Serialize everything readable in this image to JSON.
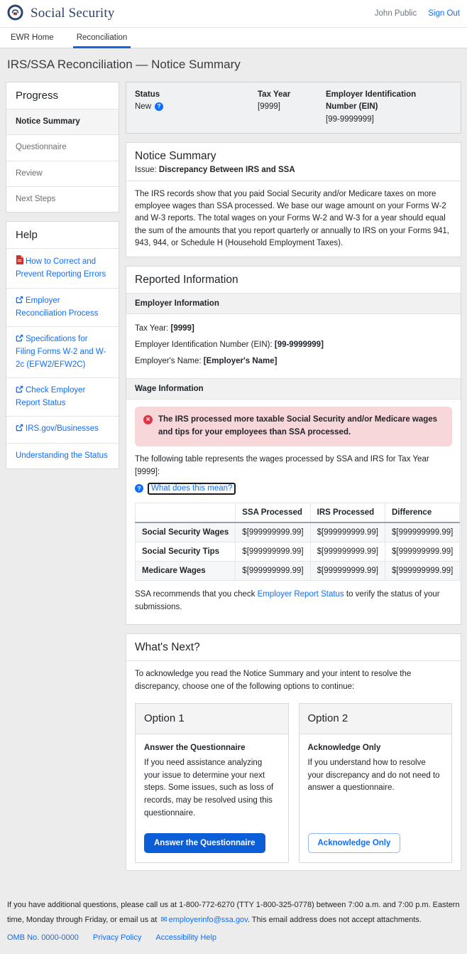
{
  "header": {
    "brand": "Social Security",
    "user_name": "John Public",
    "sign_out_label": "Sign Out"
  },
  "nav": {
    "tabs": [
      {
        "label": "EWR Home",
        "active": false
      },
      {
        "label": "Reconciliation",
        "active": true
      }
    ]
  },
  "page_title": "IRS/SSA Reconciliation — Notice Summary",
  "progress": {
    "title": "Progress",
    "steps": [
      {
        "label": "Notice Summary",
        "active": true
      },
      {
        "label": "Questionnaire",
        "active": false
      },
      {
        "label": "Review",
        "active": false
      },
      {
        "label": "Next Steps",
        "active": false
      }
    ]
  },
  "help": {
    "title": "Help",
    "links": [
      {
        "label": "How to Correct and Prevent Reporting Errors",
        "icon": "pdf-icon"
      },
      {
        "label": "Employer Reconciliation Process",
        "icon": "external-link-icon"
      },
      {
        "label": "Specifications for Filing Forms W-2 and W-2c (EFW2/EFW2C)",
        "icon": "external-link-icon"
      },
      {
        "label": "Check Employer Report Status",
        "icon": "external-link-icon"
      },
      {
        "label": "IRS.gov/Businesses",
        "icon": "external-link-icon"
      },
      {
        "label": "Understanding the Status",
        "icon": "none"
      }
    ]
  },
  "status_bar": {
    "status_label": "Status",
    "status_value": "New",
    "tax_year_label": "Tax Year",
    "tax_year_value": "[9999]",
    "ein_label": "Employer Identification Number (EIN)",
    "ein_value": "[99-9999999]"
  },
  "notice_summary": {
    "title": "Notice Summary",
    "issue_label": "Issue:",
    "issue_value": "Discrepancy Between IRS and SSA",
    "body": "The IRS records show that you paid Social Security and/or Medicare taxes on more employee wages than SSA processed. We base our wage amount on your Forms W-2 and W-3 reports. The total wages on your Forms W-2 and W-3 for a year should equal the sum of the amounts that you report quarterly or annually to IRS on your Forms 941, 943, 944, or Schedule H (Household Employment Taxes)."
  },
  "reported_information": {
    "title": "Reported Information",
    "employer_section": {
      "heading": "Employer Information",
      "tax_year_label": "Tax Year:",
      "tax_year_value": "[9999]",
      "ein_label": "Employer Identification Number (EIN):",
      "ein_value": "[99-9999999]",
      "name_label": "Employer's Name:",
      "name_value": "[Employer's Name]"
    },
    "wage_section": {
      "heading": "Wage Information",
      "alert_text": "The IRS processed more taxable Social Security and/or Medicare wages and tips for your employees than SSA processed.",
      "table_intro": "The following table represents the wages processed by SSA and IRS for Tax Year [9999]:",
      "help_link_label": "What does this mean?",
      "recommend_before": "SSA recommends that you check",
      "recommend_link": "Employer Report Status",
      "recommend_after": "to verify the status of your submissions."
    }
  },
  "chart_data": {
    "type": "table",
    "title": "Wages processed by SSA and IRS",
    "columns": [
      "",
      "SSA Processed",
      "IRS Processed",
      "Difference"
    ],
    "rows": [
      {
        "label": "Social Security Wages",
        "ssa": "$[999999999.99]",
        "irs": "$[999999999.99]",
        "diff": "$[999999999.99]"
      },
      {
        "label": "Social Security Tips",
        "ssa": "$[999999999.99]",
        "irs": "$[999999999.99]",
        "diff": "$[999999999.99]"
      },
      {
        "label": "Medicare Wages",
        "ssa": "$[999999999.99]",
        "irs": "$[999999999.99]",
        "diff": "$[999999999.99]"
      }
    ]
  },
  "whats_next": {
    "title": "What's Next?",
    "intro": "To acknowledge you read the Notice Summary and your intent to resolve the discrepancy, choose one of the following options to continue:",
    "options": [
      {
        "title": "Option 1",
        "heading": "Answer the Questionnaire",
        "description": "If you need assistance analyzing your issue to determine your next steps. Some issues, such as loss of records, may be resolved using this questionnaire.",
        "button_label": "Answer the Questionnaire"
      },
      {
        "title": "Option 2",
        "heading": "Acknowledge Only",
        "description": "If you understand how to resolve your discrepancy and do not need to answer a questionnaire.",
        "button_label": "Acknowledge Only"
      }
    ]
  },
  "footer": {
    "text_before_email": "If you have additional questions, please call us at 1-800-772-6270 (TTY 1-800-325-0778) between 7:00 a.m. and 7:00 p.m. Eastern time, Monday through Friday, or email us at",
    "email": "employerinfo@ssa.gov",
    "text_after_email": ". This email address does not accept attachments.",
    "links": [
      "OMB No. 0000-0000",
      "Privacy Policy",
      "Accessibility Help"
    ]
  },
  "icons": {
    "help_glyph": "?",
    "error_glyph": "×",
    "email_glyph": "✉"
  },
  "colors": {
    "brand_navy": "#29426f",
    "link_blue": "#0d6efd",
    "primary_button_blue": "#0b5ed7",
    "tab_underline_blue": "#1266e3",
    "alert_bg_pink": "#f8d7da",
    "alert_icon_red": "#dc3545",
    "pdf_icon_red": "#c9302c"
  }
}
